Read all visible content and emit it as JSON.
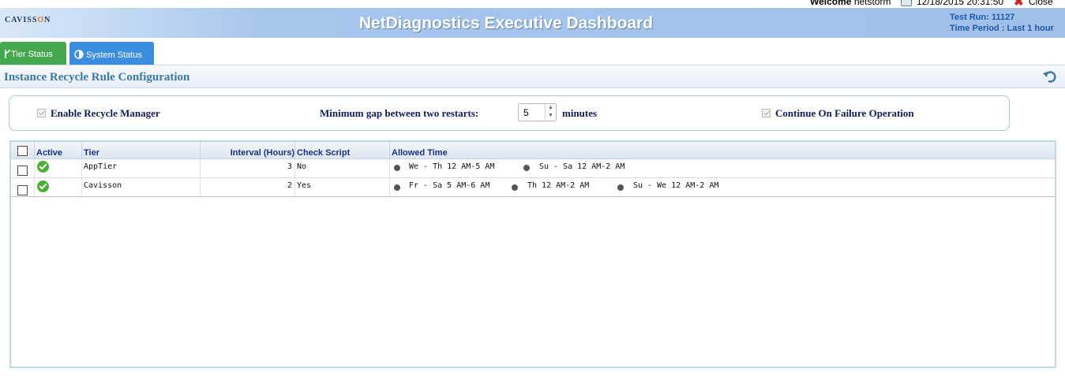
{
  "top": {
    "welcome_label": "Welcome",
    "username": "netstorm",
    "datetime": "12/18/2015 20:31:50",
    "close_label": "Close"
  },
  "header": {
    "logo_text": "Cavisson",
    "title": "NetDiagnostics Executive Dashboard",
    "test_run": "Test Run: 11127",
    "time_period": "Time Period : Last 1 hour"
  },
  "tabs": [
    {
      "label": "Tier Status",
      "icon": "branch-icon",
      "color": "#44a84e"
    },
    {
      "label": "System Status",
      "icon": "half-circle-icon",
      "color": "#3b8de0"
    }
  ],
  "section": {
    "title": "Instance Recycle Rule Configuration",
    "refresh_icon": "undo-icon"
  },
  "config": {
    "enable_label": "Enable Recycle Manager",
    "enable_checked": true,
    "gap_label": "Minimum gap between two restarts:",
    "gap_value": "5",
    "gap_unit": "minutes",
    "continue_label": "Continue On Failure Operation",
    "continue_checked": true
  },
  "table": {
    "columns": [
      "Active",
      "Tier",
      "Interval (Hours)",
      "Check Script",
      "Allowed Time"
    ],
    "rows": [
      {
        "active": true,
        "tier": "AppTier",
        "interval": "3",
        "check_script": "No",
        "allowed": [
          "We - Th 12 AM-5 AM",
          "Su - Sa 12 AM-2 AM"
        ]
      },
      {
        "active": true,
        "tier": "Cavisson",
        "interval": "2",
        "check_script": "Yes",
        "allowed": [
          "Fr - Sa 5 AM-6 AM",
          "Th 12 AM-2 AM",
          "Su - We 12 AM-2 AM"
        ]
      }
    ]
  },
  "colors": {
    "header_blue": "#a0c0ea",
    "title_navy": "#161a5a",
    "active_green": "#4caf35"
  }
}
